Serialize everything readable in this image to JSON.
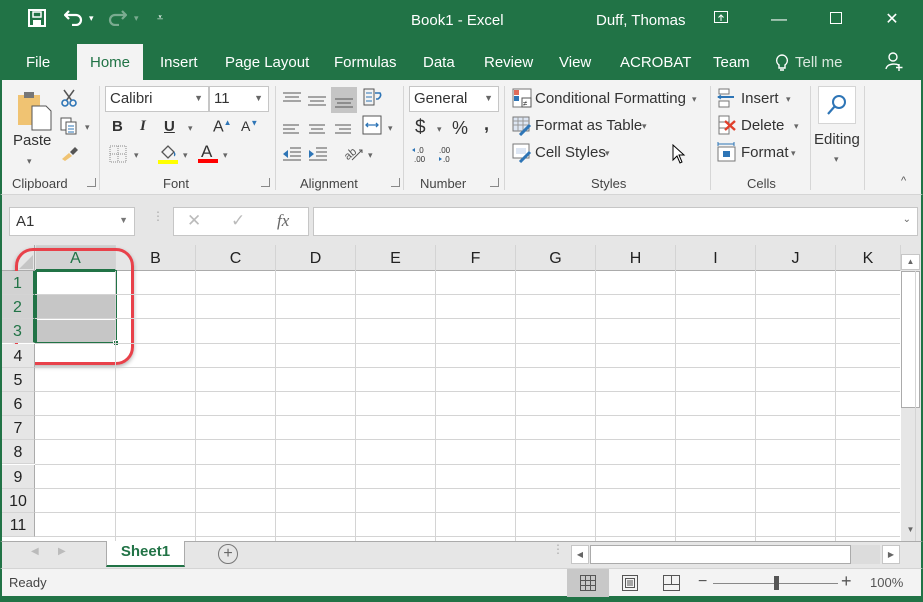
{
  "titlebar": {
    "title": "Book1  -  Excel",
    "user": "Duff, Thomas",
    "icons": [
      "save-icon",
      "undo-icon",
      "redo-icon",
      "customize-qat-icon",
      "ribbon-display-options-icon",
      "minimize-icon",
      "maximize-icon",
      "close-icon"
    ]
  },
  "tabs": {
    "file": "File",
    "home": "Home",
    "insert": "Insert",
    "page_layout": "Page Layout",
    "formulas": "Formulas",
    "data": "Data",
    "review": "Review",
    "view": "View",
    "acrobat": "ACROBAT",
    "team": "Team",
    "tell_me": "Tell me"
  },
  "ribbon": {
    "clipboard": {
      "label": "Clipboard",
      "paste": "Paste"
    },
    "font": {
      "label": "Font",
      "font_name": "Calibri",
      "font_size": "11",
      "bold": "B",
      "italic": "I",
      "underline": "U",
      "fill_color": "#ffff00",
      "font_color": "#ff0000"
    },
    "alignment": {
      "label": "Alignment"
    },
    "number": {
      "label": "Number",
      "format": "General",
      "currency": "$",
      "percent": "%",
      "comma": ","
    },
    "styles": {
      "label": "Styles",
      "conditional_formatting": "Conditional Formatting",
      "format_as_table": "Format as Table",
      "cell_styles": "Cell Styles"
    },
    "cells": {
      "label": "Cells",
      "insert": "Insert",
      "delete": "Delete",
      "format": "Format"
    },
    "editing": {
      "label": "Editing"
    }
  },
  "formula_bar": {
    "name_box": "A1",
    "formula": "",
    "fx": "fx"
  },
  "grid": {
    "columns": [
      "A",
      "B",
      "C",
      "D",
      "E",
      "F",
      "G",
      "H",
      "I",
      "J",
      "K"
    ],
    "rows": [
      "1",
      "2",
      "3",
      "4",
      "5",
      "6",
      "7",
      "8",
      "9",
      "10",
      "11"
    ],
    "selection": "A1:A3",
    "active_cell": "A1"
  },
  "sheets": {
    "tabs": [
      "Sheet1"
    ],
    "active": "Sheet1"
  },
  "status": {
    "text": "Ready",
    "zoom": "100%",
    "zoom_value": 100,
    "view_mode": "Normal"
  },
  "colors": {
    "accent": "#217346",
    "highlight_ring": "#e8414a",
    "selection_shade": "#c6c6c6"
  }
}
